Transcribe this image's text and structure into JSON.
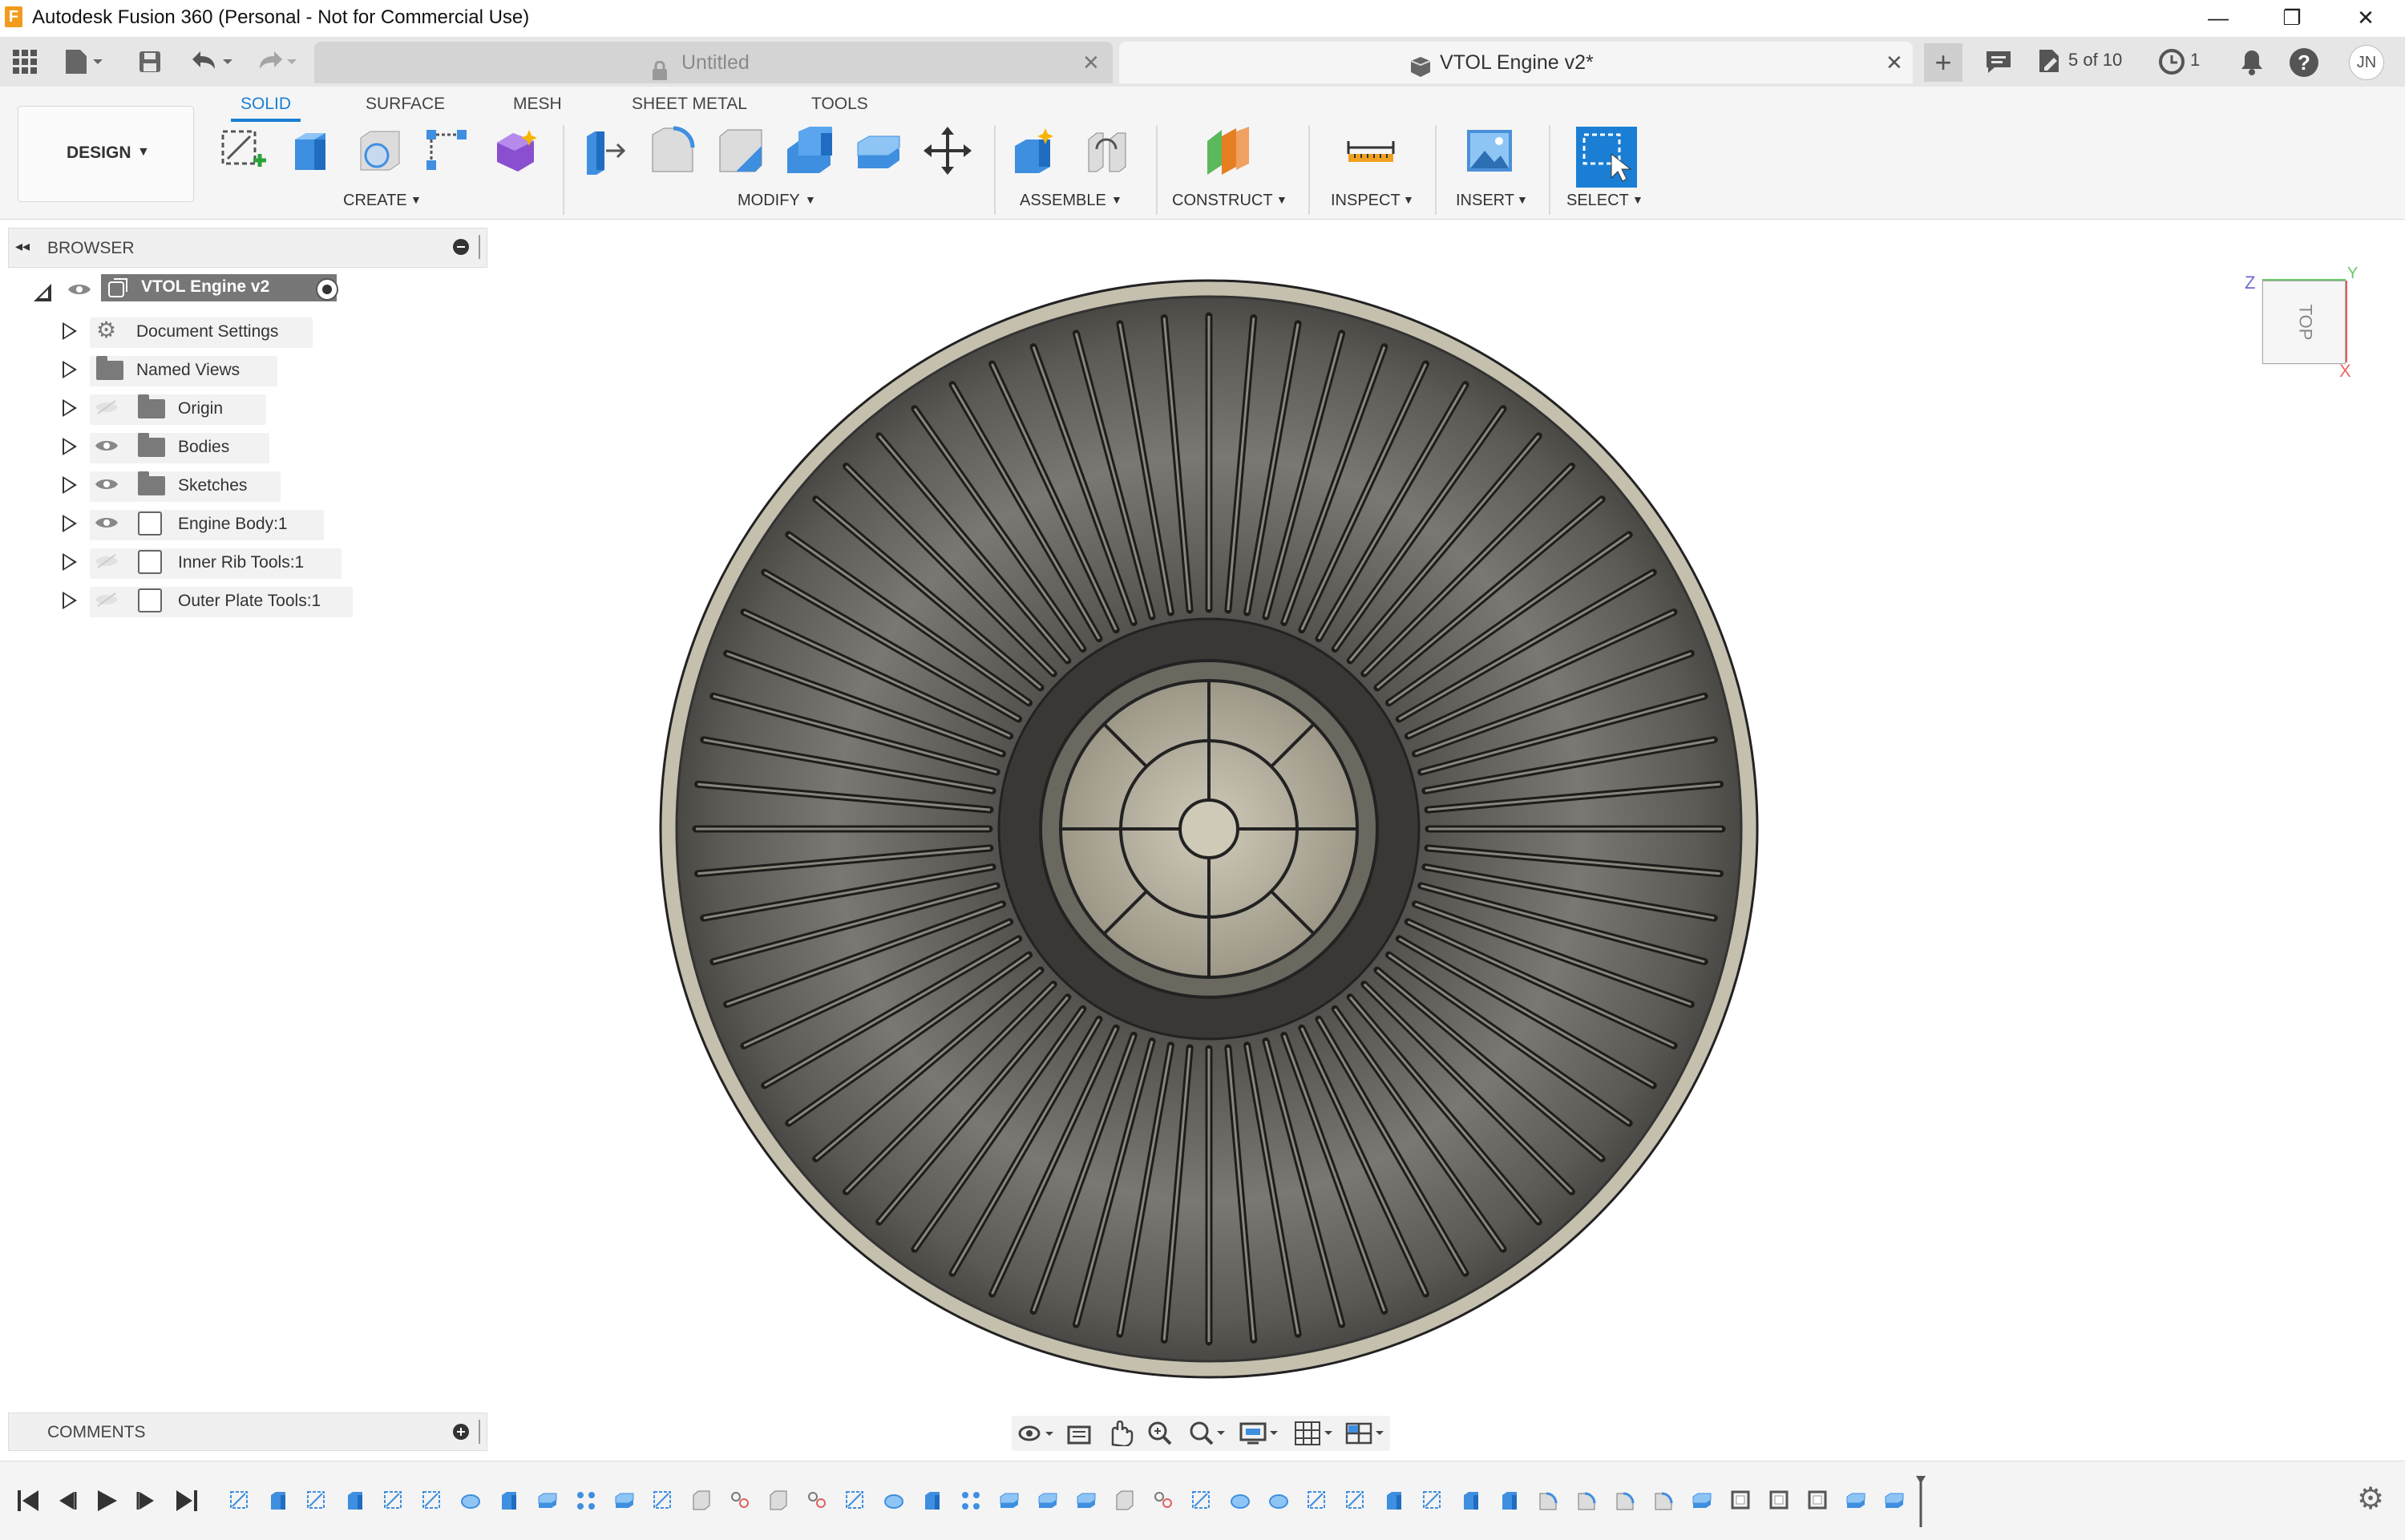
{
  "window": {
    "title": "Autodesk Fusion 360 (Personal - Not for Commercial Use)",
    "minimize": "—",
    "restore": "❐",
    "close": "✕"
  },
  "tabs": [
    {
      "label": "Untitled",
      "locked": true,
      "active": false
    },
    {
      "label": "VTOL Engine v2*",
      "active": true
    }
  ],
  "tabbar": {
    "version_label": "5 of 10",
    "jobs_count": "1",
    "user_initials": "JN"
  },
  "ribbon": {
    "workspace": "DESIGN",
    "tabs": [
      "SOLID",
      "SURFACE",
      "MESH",
      "SHEET METAL",
      "TOOLS"
    ],
    "active_tab": "SOLID",
    "groups": [
      "CREATE",
      "MODIFY",
      "ASSEMBLE",
      "CONSTRUCT",
      "INSPECT",
      "INSERT",
      "SELECT"
    ]
  },
  "browser": {
    "title": "BROWSER",
    "root": "VTOL Engine v2",
    "items": [
      {
        "label": "Document Settings",
        "icon": "gear-icon",
        "visible": null
      },
      {
        "label": "Named Views",
        "icon": "folder-icon",
        "visible": null
      },
      {
        "label": "Origin",
        "icon": "folder-icon",
        "visible": false
      },
      {
        "label": "Bodies",
        "icon": "folder-icon",
        "visible": true
      },
      {
        "label": "Sketches",
        "icon": "folder-icon",
        "visible": true
      },
      {
        "label": "Engine Body:1",
        "icon": "component-icon",
        "visible": true
      },
      {
        "label": "Inner Rib Tools:1",
        "icon": "component-icon",
        "visible": false
      },
      {
        "label": "Outer Plate Tools:1",
        "icon": "component-icon",
        "visible": false
      }
    ]
  },
  "viewcube": {
    "face": "TOP",
    "axis_z": "Z",
    "axis_y": "Y",
    "axis_x": "X"
  },
  "comments": {
    "title": "COMMENTS"
  },
  "colors": {
    "accent": "#1a7fd4",
    "ribbon_bg": "#f5f5f5",
    "model_dark": "#5a5853",
    "model_light": "#c9c3b2"
  }
}
